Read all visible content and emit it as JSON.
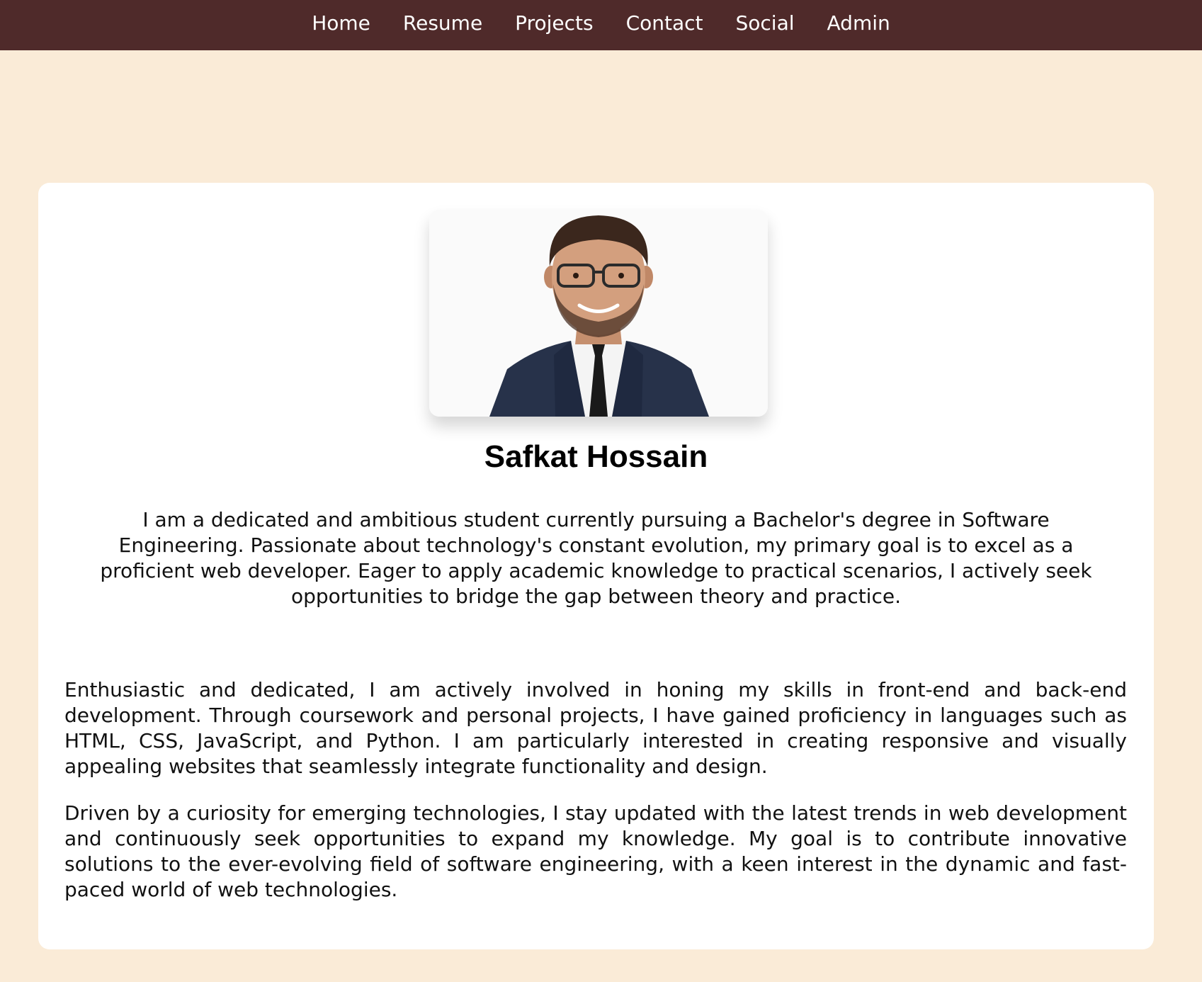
{
  "nav": {
    "items": [
      {
        "label": "Home"
      },
      {
        "label": "Resume"
      },
      {
        "label": "Projects"
      },
      {
        "label": "Contact"
      },
      {
        "label": "Social"
      },
      {
        "label": "Admin"
      }
    ]
  },
  "profile": {
    "name": "Safkat Hossain",
    "intro": "I am a dedicated and ambitious student currently pursuing a Bachelor's degree in Software Engineering. Passionate about technology's constant evolution, my primary goal is to excel as a proficient web developer. Eager to apply academic knowledge to practical scenarios, I actively seek opportunities to bridge the gap between theory and practice.",
    "paragraphs": [
      "Enthusiastic and dedicated, I am actively involved in honing my skills in front-end and back-end development. Through coursework and personal projects, I have gained proficiency in languages such as HTML, CSS, JavaScript, and Python. I am particularly interested in creating responsive and visually appealing websites that seamlessly integrate functionality and design.",
      "Driven by a curiosity for emerging technologies, I stay updated with the latest trends in web development and continuously seek opportunities to expand my knowledge. My goal is to contribute innovative solutions to the ever-evolving field of software engineering, with a keen interest in the dynamic and fast-paced world of web technologies."
    ]
  },
  "colors": {
    "navbar": "#4f2a2a",
    "page_background": "#faebd7",
    "card_background": "#ffffff"
  }
}
